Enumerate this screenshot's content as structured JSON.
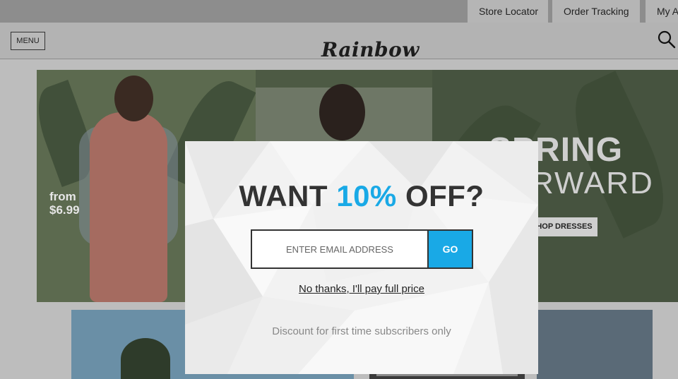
{
  "utility_nav": {
    "store_locator": "Store Locator",
    "order_tracking": "Order Tracking",
    "my_account": "My A"
  },
  "header": {
    "menu_label": "MENU",
    "logo_text": "Rainbow",
    "search_icon": "search-icon"
  },
  "hero": {
    "promo_line1": "from",
    "promo_line2": "$6.99",
    "headline_line1": "SPRING",
    "headline_line2": "RWARD",
    "cta_label": "HOP DRESSES"
  },
  "modal": {
    "title_prefix": "WANT ",
    "title_accent": "10%",
    "title_suffix": " OFF?",
    "email_placeholder": "ENTER EMAIL ADDRESS",
    "go_label": "GO",
    "decline_link": "No thanks, I'll pay full price",
    "disclaimer": "Discount for first time subscribers only",
    "accent_color": "#19a9e6"
  }
}
